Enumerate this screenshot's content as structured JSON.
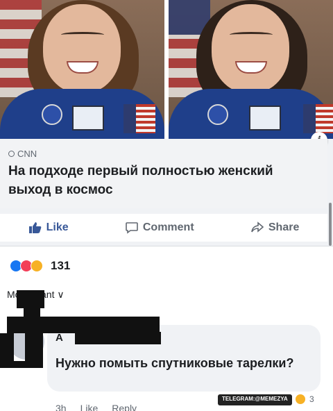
{
  "post": {
    "source": "CNN",
    "headline": "На подходе первый полностью женский выход в космос",
    "info_icon": "i"
  },
  "actions": {
    "like": "Like",
    "comment": "Comment",
    "share": "Share"
  },
  "reactions": {
    "count": "131"
  },
  "sort": {
    "label": "Most relevant ∨",
    "visible_label": "Mo   elevant ∨"
  },
  "comment": {
    "author_visible": "A",
    "text": "Нужно помыть спутниковые тарелки?",
    "time": "3h",
    "like": "Like",
    "reply": "Reply",
    "reaction_count": "3"
  },
  "watermark": "TELEGRAM:@MEMEZYA",
  "colors": {
    "like_blue": "#385898",
    "card_bg": "#f2f3f5",
    "suit_blue": "#1f3f8a"
  }
}
